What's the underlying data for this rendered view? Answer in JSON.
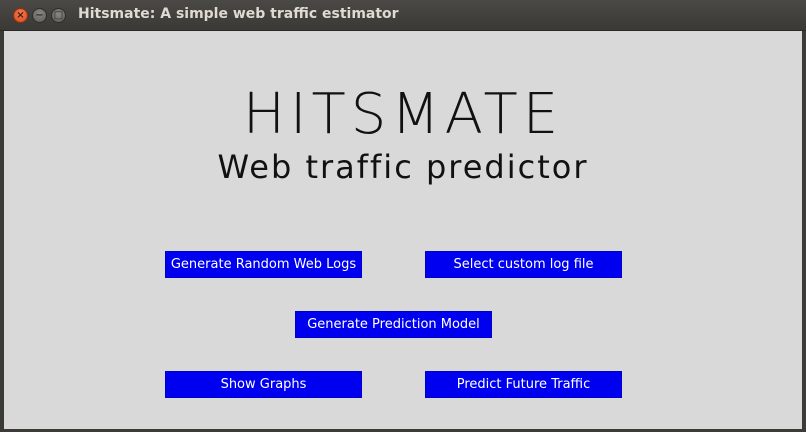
{
  "window": {
    "title": "Hitsmate: A simple web traffic estimator",
    "close_glyph": "×",
    "minimize_glyph": "−",
    "maximize_glyph": "□"
  },
  "main": {
    "heading": "HITSMATE",
    "subheading": "Web traffic predictor"
  },
  "buttons": {
    "generate_logs": "Generate Random Web Logs",
    "select_log": "Select custom log file",
    "generate_model": "Generate Prediction Model",
    "show_graphs": "Show Graphs",
    "predict_traffic": "Predict Future Traffic"
  },
  "colors": {
    "button_bg": "#0000f0",
    "button_text": "#ffffff",
    "window_bg": "#d9d9d9",
    "titlebar_bg": "#3c3b37"
  }
}
